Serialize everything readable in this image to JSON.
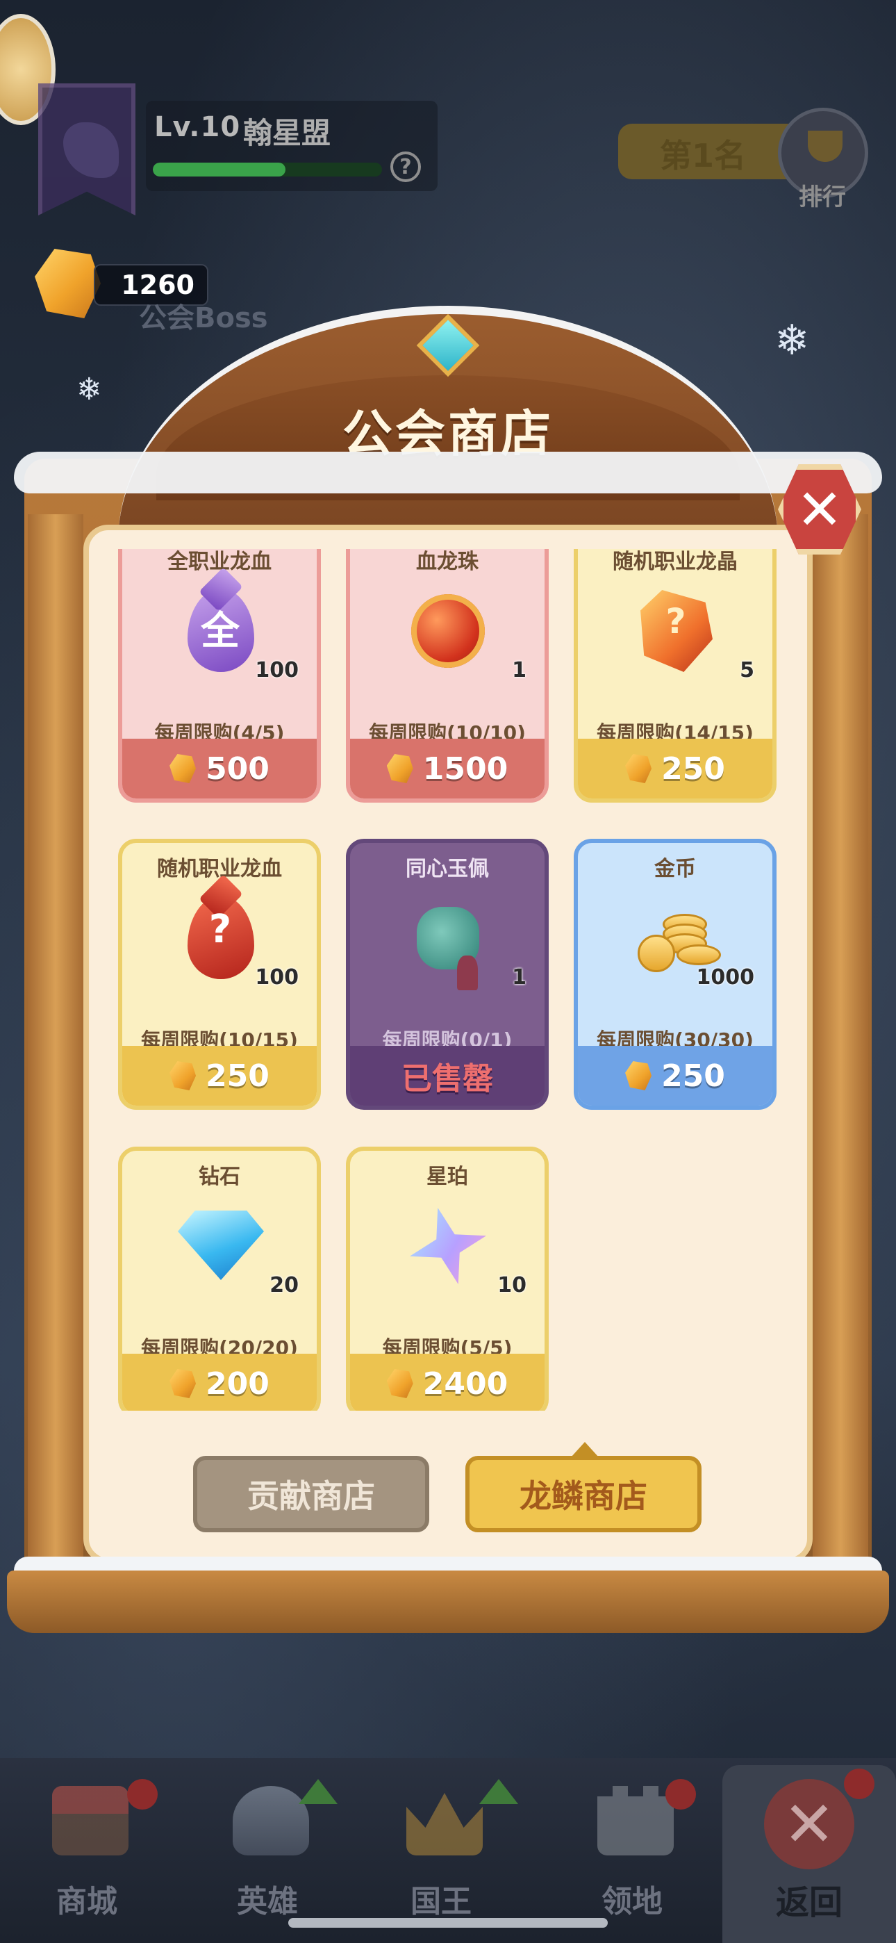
{
  "guild": {
    "level": "Lv.10",
    "name": "翰星盟",
    "exp_fraction": 0.58,
    "rank_text": "第1名",
    "rank_label": "排行",
    "boss_label": "公会Boss"
  },
  "currency": {
    "dragon_scale": "1260"
  },
  "shop": {
    "title": "公会商店",
    "items": [
      {
        "name": "全职业龙血",
        "qty": "100",
        "limit": "每周限购(4/5)",
        "price": "500",
        "theme": "pink",
        "icon": "purple-drop-icon",
        "glyph": "全"
      },
      {
        "name": "血龙珠",
        "qty": "1",
        "limit": "每周限购(10/10)",
        "price": "1500",
        "theme": "pink",
        "icon": "red-orb-icon"
      },
      {
        "name": "随机职业龙晶",
        "qty": "5",
        "limit": "每周限购(14/15)",
        "price": "250",
        "theme": "gold",
        "icon": "orange-crystal-icon",
        "glyph": "?"
      },
      {
        "name": "随机职业龙血",
        "qty": "100",
        "limit": "每周限购(10/15)",
        "price": "250",
        "theme": "gold",
        "icon": "red-drop-icon",
        "glyph": "?"
      },
      {
        "name": "同心玉佩",
        "qty": "1",
        "limit": "每周限购(0/1)",
        "price": "已售罄",
        "theme": "purple",
        "icon": "jade-pendant-icon",
        "soldout": true
      },
      {
        "name": "金币",
        "qty": "1000",
        "limit": "每周限购(30/30)",
        "price": "250",
        "theme": "blue",
        "icon": "gold-coins-icon"
      },
      {
        "name": "钻石",
        "qty": "20",
        "limit": "每周限购(20/20)",
        "price": "200",
        "theme": "gold",
        "icon": "diamond-icon"
      },
      {
        "name": "星珀",
        "qty": "10",
        "limit": "每周限购(5/5)",
        "price": "2400",
        "theme": "gold",
        "icon": "star-gem-icon"
      }
    ],
    "tabs": {
      "contribution": "贡献商店",
      "dragon_scale": "龙鳞商店"
    }
  },
  "nav": {
    "shop": "商城",
    "hero": "英雄",
    "king": "国王",
    "territory": "领地",
    "back": "返回"
  },
  "colors": {
    "gold_card": "#fbf0c2",
    "pink_card": "#f8d6d4",
    "purple_card": "#7d5e8e",
    "blue_card": "#cbe4fb",
    "soldout_text": "#ee6f6f"
  }
}
